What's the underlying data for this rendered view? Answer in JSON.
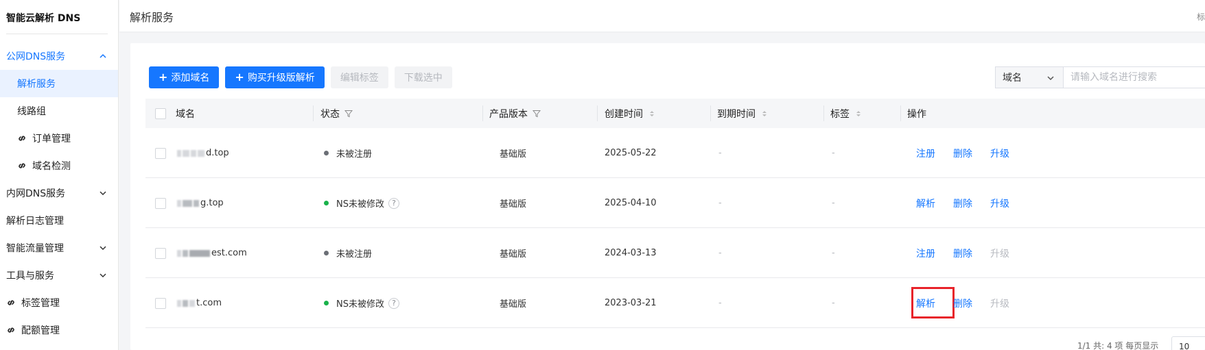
{
  "app": {
    "title": "智能云解析 DNS"
  },
  "sidebar": {
    "items": [
      {
        "label": "公网DNS服务"
      },
      {
        "label": "解析服务"
      },
      {
        "label": "线路组"
      },
      {
        "label": "订单管理"
      },
      {
        "label": "域名检测"
      },
      {
        "label": "内网DNS服务"
      },
      {
        "label": "解析日志管理"
      },
      {
        "label": "智能流量管理"
      },
      {
        "label": "工具与服务"
      },
      {
        "label": "标签管理"
      },
      {
        "label": "配额管理"
      }
    ]
  },
  "header": {
    "title": "解析服务",
    "right_text": "标"
  },
  "toolbar": {
    "add_domain": "添加域名",
    "buy_upgrade": "购买升级版解析",
    "edit_tags": "编辑标签",
    "download_selected": "下载选中"
  },
  "search": {
    "field": "域名",
    "placeholder": "请输入域名进行搜索"
  },
  "table": {
    "columns": [
      "域名",
      "状态",
      "产品版本",
      "创建时间",
      "到期时间",
      "标签",
      "操作"
    ],
    "rows": [
      {
        "domain_suffix": "d.top",
        "status": "未被注册",
        "status_color": "#6b6f76",
        "version": "基础版",
        "created": "2025-05-22",
        "expires": "-",
        "tag": "-",
        "op1": "注册",
        "op2": "删除",
        "op3": "升级",
        "op3_disabled": false
      },
      {
        "domain_suffix": "g.top",
        "status": "NS未被修改",
        "status_color": "#19b24b",
        "version": "基础版",
        "created": "2025-04-10",
        "expires": "-",
        "tag": "-",
        "op1": "解析",
        "op2": "删除",
        "op3": "升级",
        "op3_disabled": false
      },
      {
        "domain_suffix": "est.com",
        "status": "未被注册",
        "status_color": "#6b6f76",
        "version": "基础版",
        "created": "2024-03-13",
        "expires": "-",
        "tag": "-",
        "op1": "注册",
        "op2": "删除",
        "op3": "升级",
        "op3_disabled": true
      },
      {
        "domain_suffix": "t.com",
        "status": "NS未被修改",
        "status_color": "#19b24b",
        "version": "基础版",
        "created": "2023-03-21",
        "expires": "-",
        "tag": "-",
        "op1": "解析",
        "op2": "删除",
        "op3": "升级",
        "op3_disabled": true
      }
    ]
  },
  "pagination": {
    "summary": "1/1 共: 4 项  每页显示",
    "page_size": "10"
  },
  "colors": {
    "accent": "#1677ff",
    "highlight": "#e8232a"
  }
}
